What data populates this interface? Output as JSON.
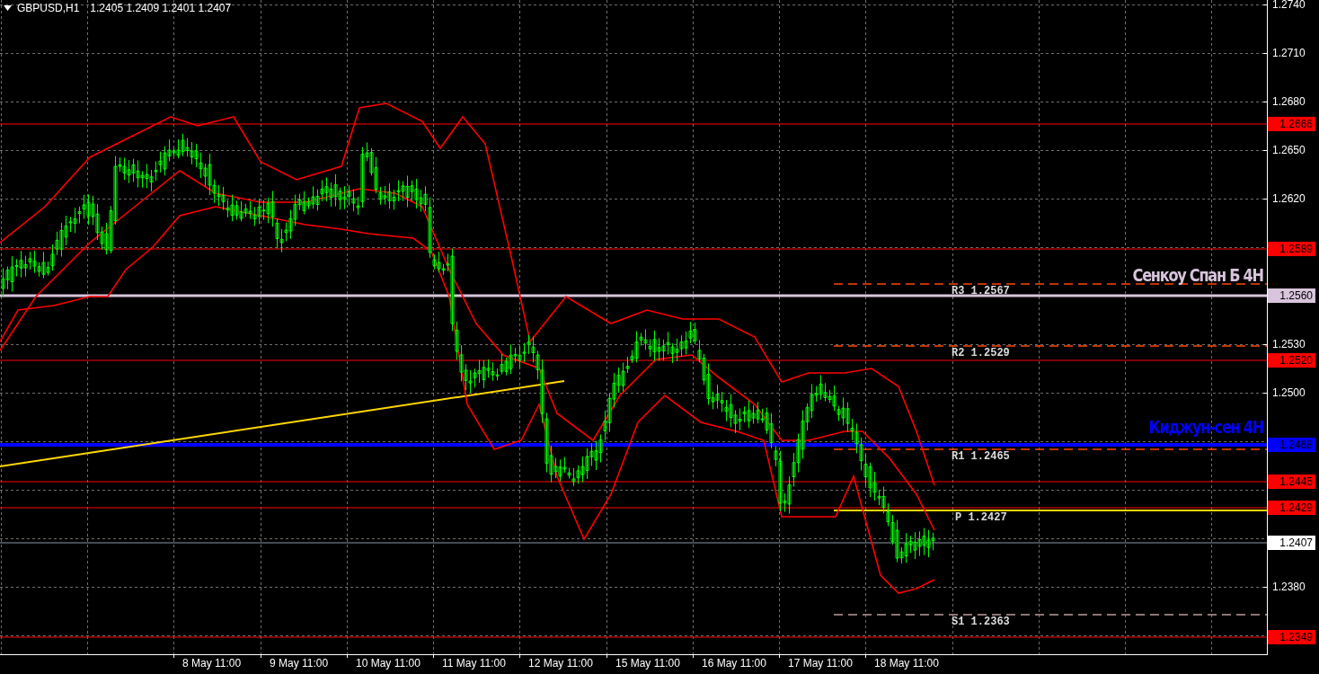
{
  "header": {
    "symbol": "GBPUSD,H1",
    "ohlc": "1.2405 1.2409 1.2401 1.2407"
  },
  "price_axis": {
    "ticks": [
      "1.2740",
      "1.2710",
      "1.2680",
      "1.2650",
      "1.2620",
      "1.2530",
      "1.2500",
      "1.2380"
    ]
  },
  "price_labels": [
    {
      "text": "1.2666",
      "color": "#ff0000"
    },
    {
      "text": "1.2589",
      "color": "#ff0000"
    },
    {
      "text": "1.2560",
      "color": "#d8c4dc"
    },
    {
      "text": "1.2520",
      "color": "#ff0000"
    },
    {
      "text": "1.2468",
      "color": "#0000ff"
    },
    {
      "text": "1.2445",
      "color": "#ff0000"
    },
    {
      "text": "1.2429",
      "color": "#ff0000"
    },
    {
      "text": "1.2407",
      "color": "#ffffff"
    },
    {
      "text": "1.2349",
      "color": "#ff0000"
    }
  ],
  "pivot_levels": [
    {
      "label": "R3 1.2567"
    },
    {
      "label": "R2 1.2529"
    },
    {
      "label": "R1 1.2465"
    },
    {
      "label": "P 1.2427"
    },
    {
      "label": "S1 1.2363"
    }
  ],
  "annotations": [
    {
      "text": "Сенкоу Спан Б 4H",
      "color": "#d8c4dc"
    },
    {
      "text": "Киджун-сен 4H",
      "color": "#0000ff"
    }
  ],
  "time_axis": {
    "ticks": [
      "8 May 11:00",
      "9 May 11:00",
      "10 May 11:00",
      "11 May 11:00",
      "12 May 11:00",
      "15 May 11:00",
      "16 May 11:00",
      "17 May 11:00",
      "18 May 11:00"
    ]
  }
}
